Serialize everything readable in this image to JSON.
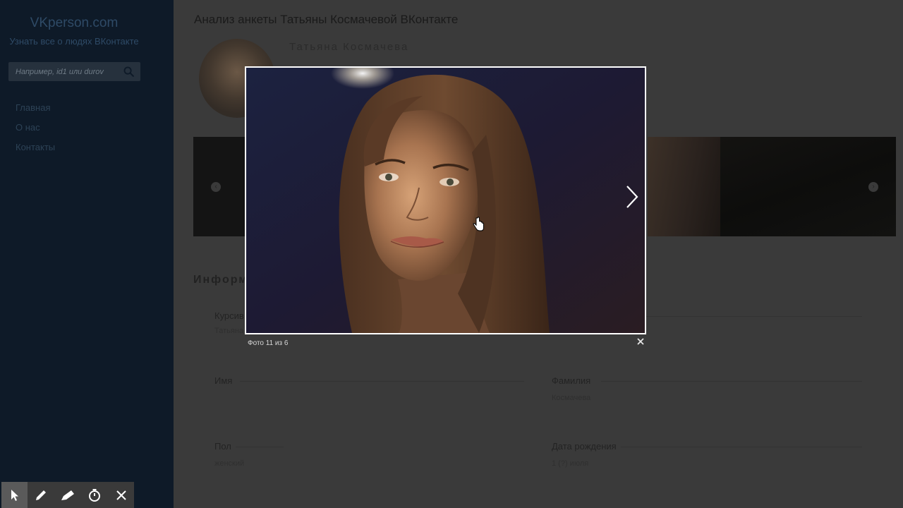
{
  "sidebar": {
    "site_title": "VKperson.com",
    "site_subtitle": "Узнать все о людях ВКонтакте",
    "search_placeholder": "Например, id1 или durov",
    "nav": [
      {
        "label": "Главная"
      },
      {
        "label": "О нас"
      },
      {
        "label": "Контакты"
      }
    ]
  },
  "page": {
    "header": "Анализ анкеты Татьяны Космачевой ВКонтакте",
    "profile_name": "Татьяна Космачева",
    "info_heading": "Информ",
    "fields": {
      "first_name_label": "Имя",
      "last_name_label": "Фамилия",
      "last_name_value": "Космачева",
      "gender_label": "Пол",
      "gender_value": "женский",
      "birthdate_label": "Дата рождения",
      "birthdate_value": "1 (?) июля",
      "top_field_label": "Курсив",
      "top_field_value": "Татьяна"
    }
  },
  "lightbox": {
    "counter": "Фото 11 из 6"
  },
  "toolbar": {
    "tools": [
      "pointer-icon",
      "pen-icon",
      "highlighter-icon",
      "timer-icon",
      "close-icon"
    ]
  },
  "colors": {
    "sidebar_bg": "#0e1a28",
    "overlay_bg": "#3a3a3a",
    "frame_border": "#ffffff"
  }
}
